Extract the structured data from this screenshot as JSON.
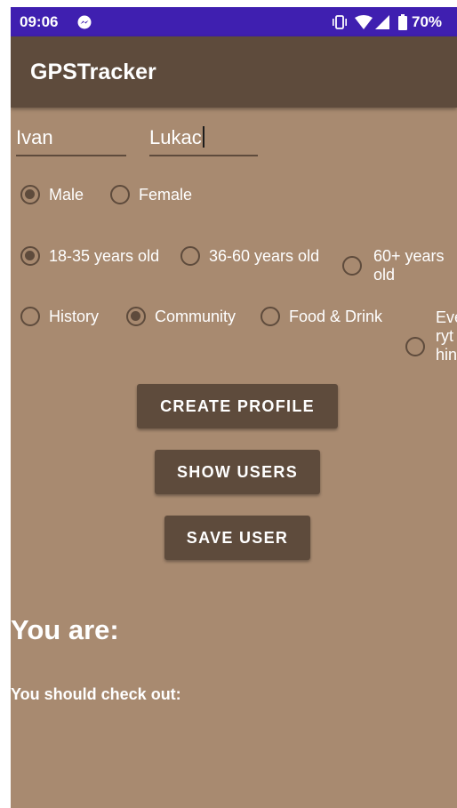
{
  "status_bar": {
    "time": "09:06",
    "battery": "70%",
    "icons": [
      "messenger-icon",
      "vibrate-icon",
      "wifi-icon",
      "signal-icon",
      "battery-icon"
    ]
  },
  "app_bar": {
    "title": "GPSTracker"
  },
  "form": {
    "first_name": "Ivan",
    "last_name": "Lukac",
    "gender": {
      "options": [
        "Male",
        "Female"
      ],
      "selected": "Male"
    },
    "age": {
      "options": [
        "18-35 years old",
        "36-60 years old",
        "60+ years old"
      ],
      "option3_lines": [
        "60+ years",
        "old"
      ],
      "selected": "18-35 years old"
    },
    "interest": {
      "options": [
        "History",
        "Community",
        "Food & Drink",
        "Everything"
      ],
      "option4_lines": [
        "Eve",
        "ryt",
        "hin"
      ],
      "selected": "Community"
    }
  },
  "buttons": {
    "create_profile": "CREATE PROFILE",
    "show_users": "SHOW USERS",
    "save_user": "SAVE USER"
  },
  "result": {
    "heading": "You are:",
    "subheading": "You should check out:"
  },
  "colors": {
    "status_bar": "#3f1fb0",
    "app_bar": "#5e4b3c",
    "background": "#a88a70",
    "accent": "#5e4b3c",
    "text": "#ffffff"
  }
}
